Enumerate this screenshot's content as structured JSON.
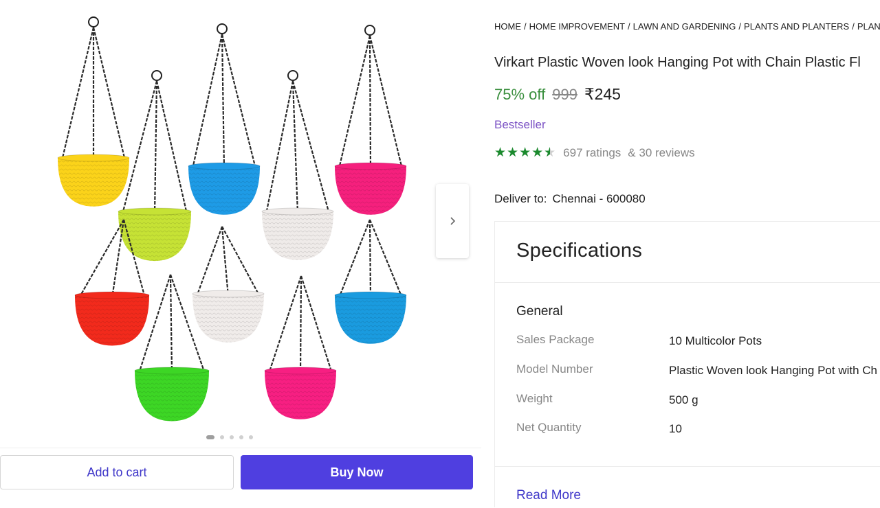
{
  "breadcrumb": [
    {
      "label": "HOME"
    },
    {
      "label": "HOME IMPROVEMENT"
    },
    {
      "label": "LAWN AND GARDENING"
    },
    {
      "label": "PLANTS AND PLANTERS"
    },
    {
      "label": "PLANT C"
    }
  ],
  "breadcrumb_separator": "/",
  "product": {
    "title": "Virkart Plastic Woven look Hanging Pot with Chain Plastic Fl",
    "discount": "75% off",
    "mrp": "999",
    "price": "₹245",
    "badge": "Bestseller",
    "rating_value": 4.5,
    "stars_glyphs": "★★★★★",
    "ratings_text": "697 ratings",
    "reviews_text": "& 30 reviews"
  },
  "delivery": {
    "label": "Deliver to:",
    "location": "Chennai - 600080"
  },
  "gallery": {
    "dots_count": 5,
    "active_dot": 0,
    "next_icon": "chevron-right-icon",
    "pot_colors": [
      "#fbd31a",
      "#c6e235",
      "#1e9be6",
      "#efebe9",
      "#f5207d",
      "#f22a1c",
      "#f0ecea",
      "#1a9bdf",
      "#3dd625",
      "#f71f82"
    ]
  },
  "actions": {
    "add_to_cart": "Add to cart",
    "buy_now": "Buy Now"
  },
  "specifications": {
    "title": "Specifications",
    "group": "General",
    "rows": [
      {
        "key": "Sales Package",
        "value": "10 Multicolor Pots"
      },
      {
        "key": "Model Number",
        "value": "Plastic Woven look Hanging Pot with Ch"
      },
      {
        "key": "Weight",
        "value": "500 g"
      },
      {
        "key": "Net Quantity",
        "value": "10"
      }
    ],
    "read_more": "Read More"
  },
  "colors": {
    "accent": "#4f3fe0",
    "link": "#3f37c9",
    "discount_green": "#388e3c",
    "star_green": "#1b8a2e",
    "badge_purple": "#7b52c4"
  }
}
